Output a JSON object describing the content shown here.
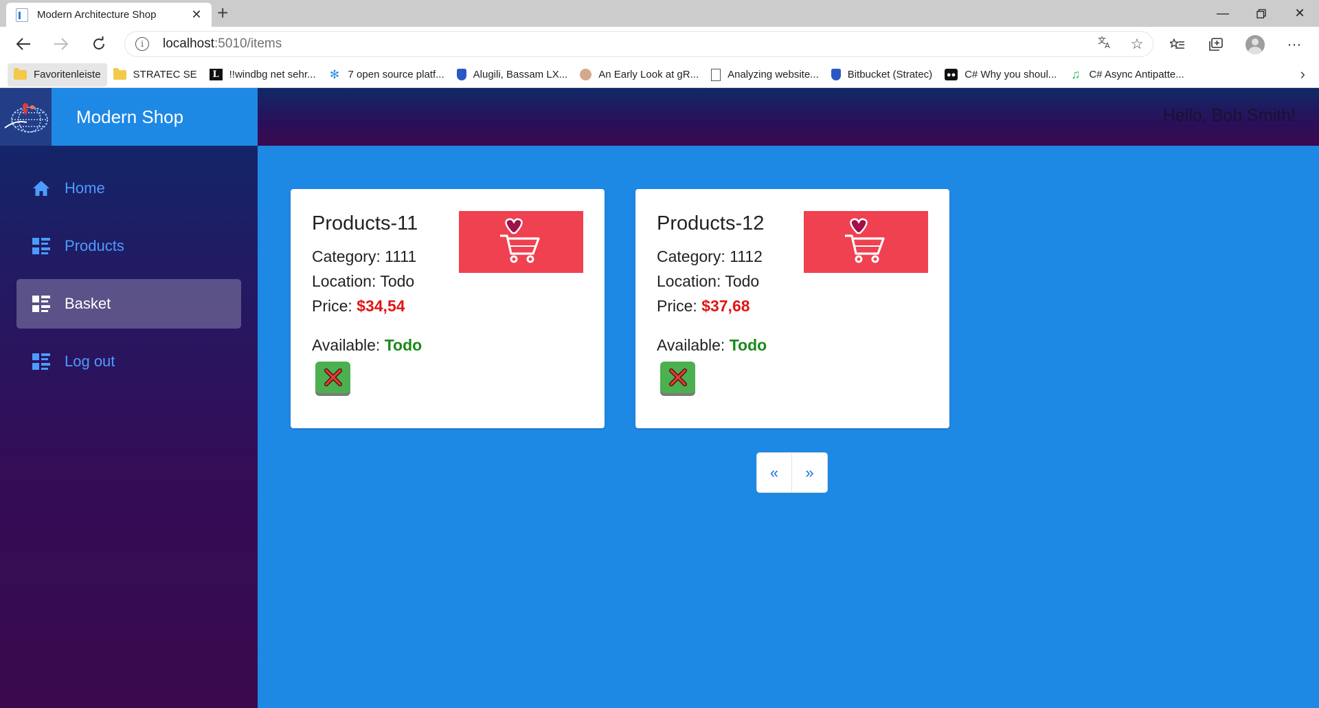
{
  "browser": {
    "tab_title": "Modern Architecture Shop",
    "url_host": "localhost",
    "url_path": ":5010/items",
    "favorites": [
      {
        "label": "Favoritenleiste",
        "icon": "folder-icon"
      },
      {
        "label": "STRATEC SE",
        "icon": "folder-icon"
      },
      {
        "label": "!!windbg  net sehr...",
        "icon": "site-l-icon"
      },
      {
        "label": "7 open source platf...",
        "icon": "snowflake-icon"
      },
      {
        "label": "Alugili, Bassam   LX...",
        "icon": "bitbucket-icon"
      },
      {
        "label": "An Early Look at gR...",
        "icon": "person-icon"
      },
      {
        "label": "Analyzing website...",
        "icon": "document-icon"
      },
      {
        "label": "Bitbucket (Stratec)",
        "icon": "bitbucket-icon"
      },
      {
        "label": "C#  Why you shoul...",
        "icon": "medium-icon"
      },
      {
        "label": "C# Async Antipatte...",
        "icon": "music-icon"
      }
    ]
  },
  "app": {
    "brand": "Modern Shop",
    "greeting": "Hello, Bob Smith!",
    "nav": [
      {
        "label": "Home",
        "icon": "home-icon"
      },
      {
        "label": "Products",
        "icon": "list-icon"
      },
      {
        "label": "Basket",
        "icon": "list-icon",
        "active": true
      },
      {
        "label": "Log out",
        "icon": "list-icon"
      }
    ],
    "items": [
      {
        "title": "Products-11",
        "category_label": "Category: ",
        "category": "1111",
        "location_label": "Location: ",
        "location": "Todo",
        "price_label": "Price: ",
        "price": "$34,54",
        "available_label": "Available: ",
        "available": "Todo"
      },
      {
        "title": "Products-12",
        "category_label": "Category: ",
        "category": "1112",
        "location_label": "Location: ",
        "location": "Todo",
        "price_label": "Price: ",
        "price": "$37,68",
        "available_label": "Available: ",
        "available": "Todo"
      }
    ],
    "pager": {
      "prev": "«",
      "next": "»"
    },
    "colors": {
      "accent": "#1e88e5",
      "price": "#e01515",
      "available": "#198a19",
      "image_bg": "#ef4150",
      "remove_button": "#4caf50"
    }
  }
}
